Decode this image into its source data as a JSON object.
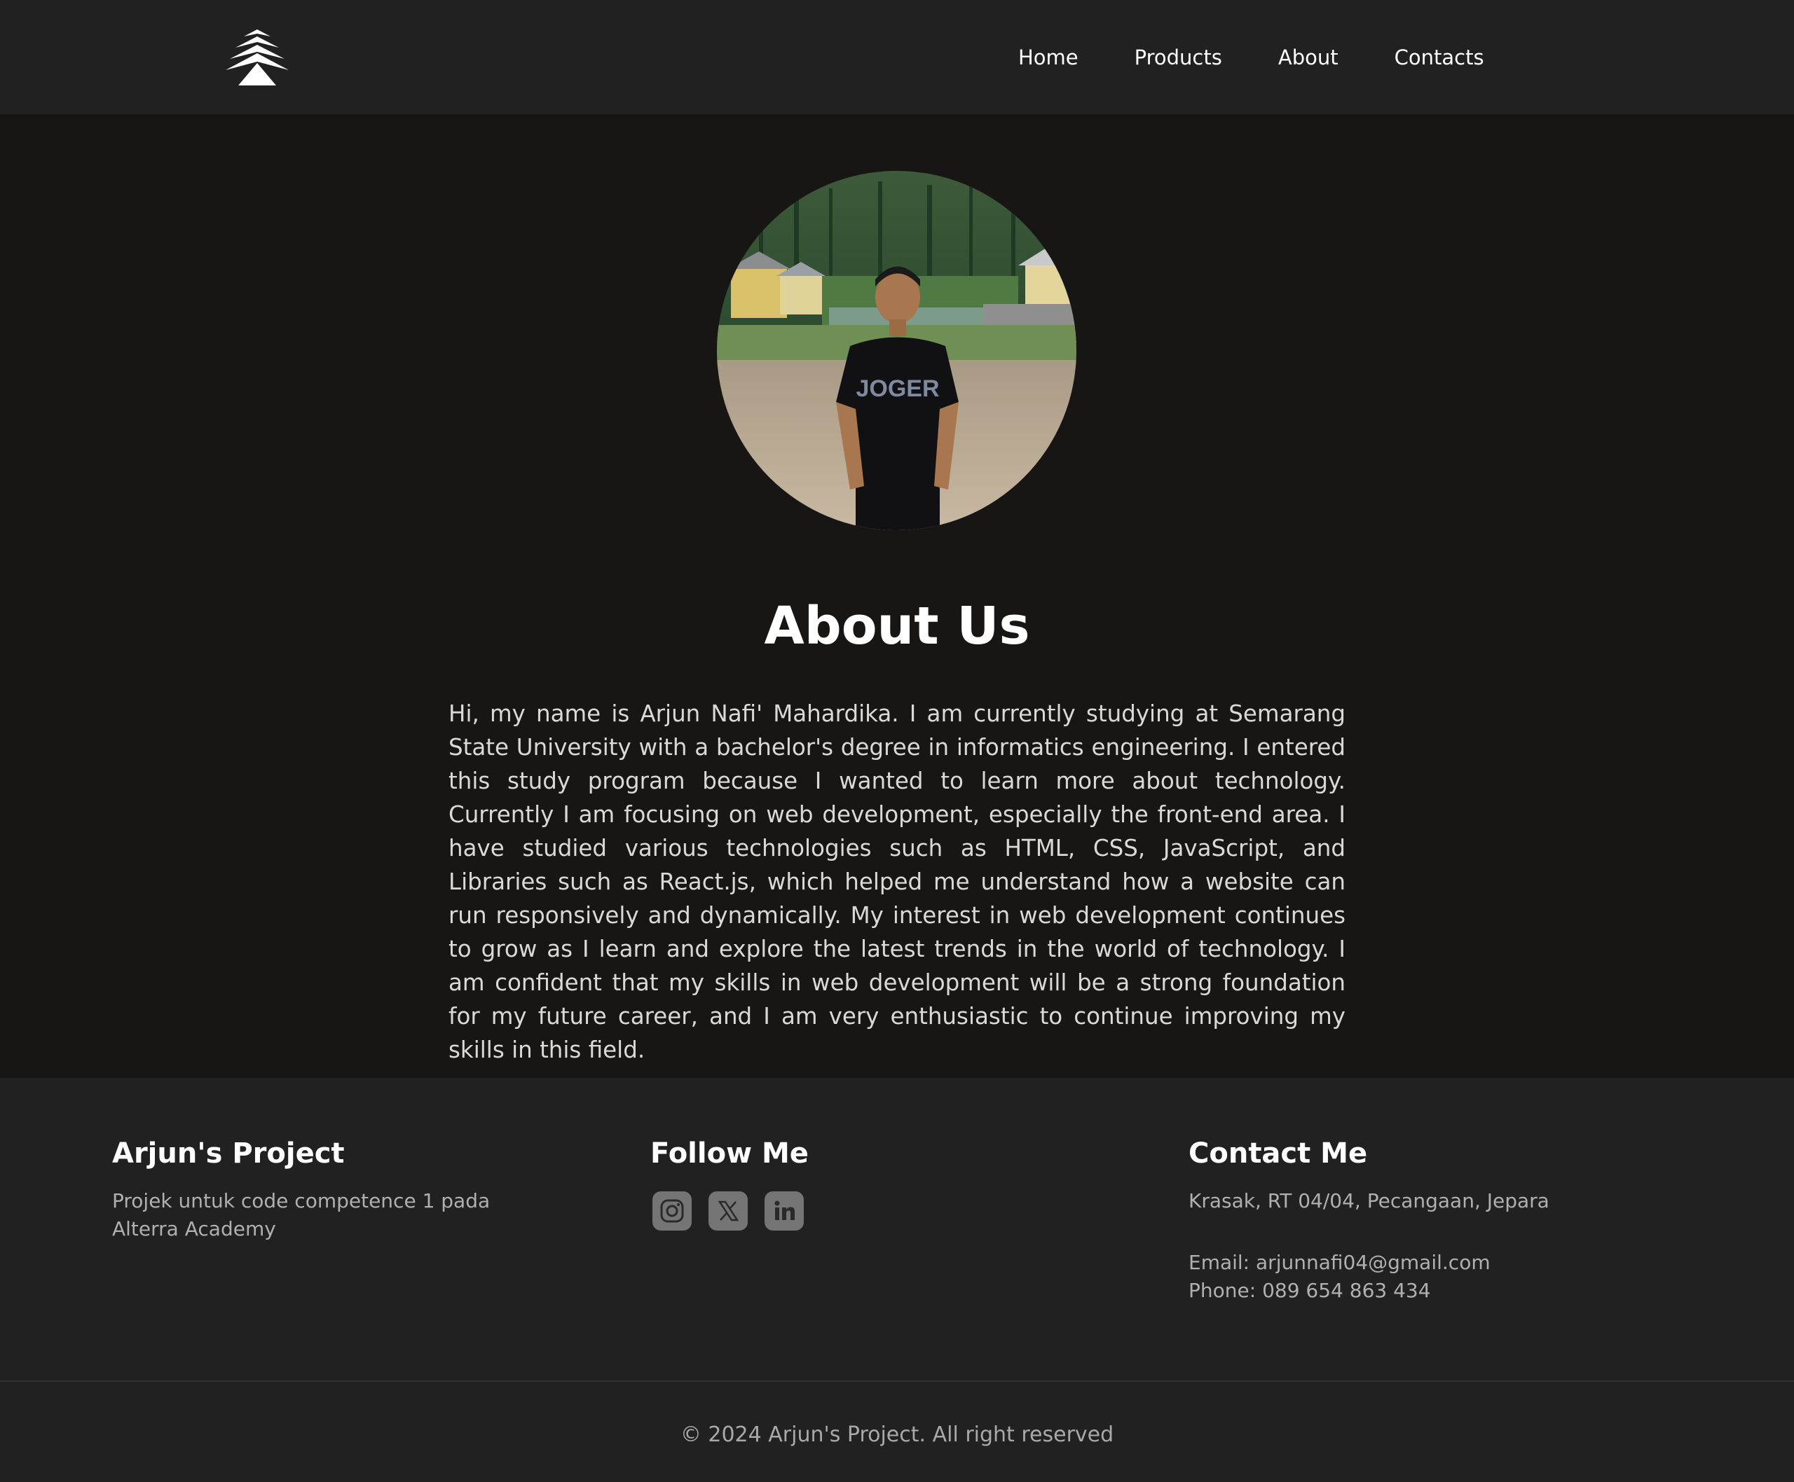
{
  "nav": {
    "logo_icon": "pine-tree-logo-icon",
    "links": [
      {
        "label": "Home"
      },
      {
        "label": "Products"
      },
      {
        "label": "About"
      },
      {
        "label": "Contacts"
      }
    ]
  },
  "about": {
    "title": "About Us",
    "body": "Hi, my name is Arjun Nafi' Mahardika. I am currently studying at Semarang State University with a bachelor's degree in informatics engineering. I entered this study program because I wanted to learn more about technology. Currently I am focusing on web development, especially the front-end area. I have studied various technologies such as HTML, CSS, JavaScript, and Libraries such as React.js, which helped me understand how a website can run responsively and dynamically. My interest in web development continues to grow as I learn and explore the latest trends in the world of technology. I am confident that my skills in web development will be a strong foundation for my future career, and I am very enthusiastic to continue improving my skills in this field.",
    "photo_shirt_text": "JOGER"
  },
  "footer": {
    "brand": {
      "title": "Arjun's Project",
      "description": "Projek untuk code competence 1 pada Alterra Academy"
    },
    "follow": {
      "title": "Follow Me",
      "icons": [
        "instagram-icon",
        "x-twitter-icon",
        "linkedin-icon"
      ]
    },
    "contact": {
      "title": "Contact Me",
      "address": "Krasak, RT 04/04, Pecangaan, Jepara",
      "email": "Email: arjunnafi04@gmail.com",
      "phone": "Phone: 089 654 863 434"
    },
    "copyright": "© 2024 Arjun's Project. All right reserved"
  },
  "colors": {
    "nav_bg": "#212121",
    "main_bg": "#171615",
    "footer_bg": "#212121",
    "icon_bg": "#757575"
  }
}
